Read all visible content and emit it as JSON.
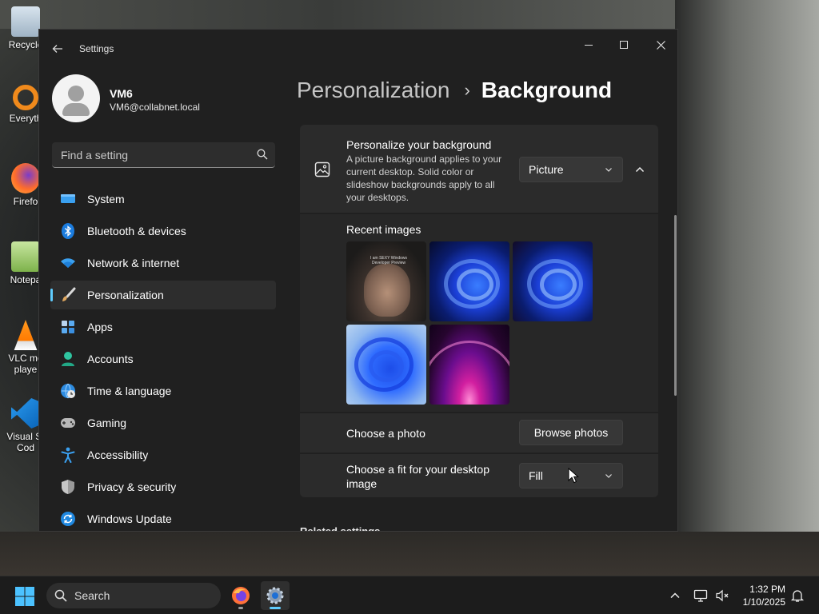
{
  "desktop": {
    "icons": [
      {
        "label": "Recycle",
        "icon": "recycle-bin-icon"
      },
      {
        "label": "Everyth",
        "icon": "everything-icon"
      },
      {
        "label": "Firefo",
        "icon": "firefox-icon"
      },
      {
        "label": "Notepa",
        "icon": "notepad-icon"
      },
      {
        "label": "VLC me playe",
        "icon": "vlc-icon"
      },
      {
        "label": "Visual St Cod",
        "icon": "vscode-icon"
      }
    ]
  },
  "window": {
    "title": "Settings",
    "back_icon": "arrow-left-icon",
    "controls": [
      "minimize",
      "maximize",
      "close"
    ]
  },
  "user": {
    "name": "VM6",
    "email": "VM6@collabnet.local"
  },
  "search": {
    "placeholder": "Find a setting"
  },
  "nav": {
    "items": [
      {
        "label": "System",
        "icon": "display-icon"
      },
      {
        "label": "Bluetooth & devices",
        "icon": "bluetooth-icon"
      },
      {
        "label": "Network & internet",
        "icon": "wifi-icon"
      },
      {
        "label": "Personalization",
        "icon": "paintbrush-icon",
        "active": true
      },
      {
        "label": "Apps",
        "icon": "apps-icon"
      },
      {
        "label": "Accounts",
        "icon": "person-icon"
      },
      {
        "label": "Time & language",
        "icon": "globe-clock-icon"
      },
      {
        "label": "Gaming",
        "icon": "gamepad-icon"
      },
      {
        "label": "Accessibility",
        "icon": "accessibility-icon"
      },
      {
        "label": "Privacy & security",
        "icon": "shield-icon"
      },
      {
        "label": "Windows Update",
        "icon": "update-icon"
      }
    ]
  },
  "breadcrumb": {
    "parent": "Personalization",
    "separator": "›",
    "current": "Background"
  },
  "background": {
    "title": "Personalize your background",
    "description": "A picture background applies to your current desktop. Solid color or slideshow backgrounds apply to all your desktops.",
    "type_value": "Picture",
    "recent_title": "Recent images",
    "recent_images": [
      {
        "caption": "I am SEXY Windows Developer Preview"
      },
      {
        "caption": ""
      },
      {
        "caption": ""
      },
      {
        "caption": ""
      },
      {
        "caption": ""
      }
    ],
    "choose_photo_label": "Choose a photo",
    "browse_label": "Browse photos",
    "fit_label": "Choose a fit for your desktop image",
    "fit_value": "Fill"
  },
  "related": {
    "title": "Related settings"
  },
  "taskbar": {
    "search_label": "Search",
    "time": "1:32 PM",
    "date": "1/10/2025",
    "accent": "#60cdff"
  }
}
